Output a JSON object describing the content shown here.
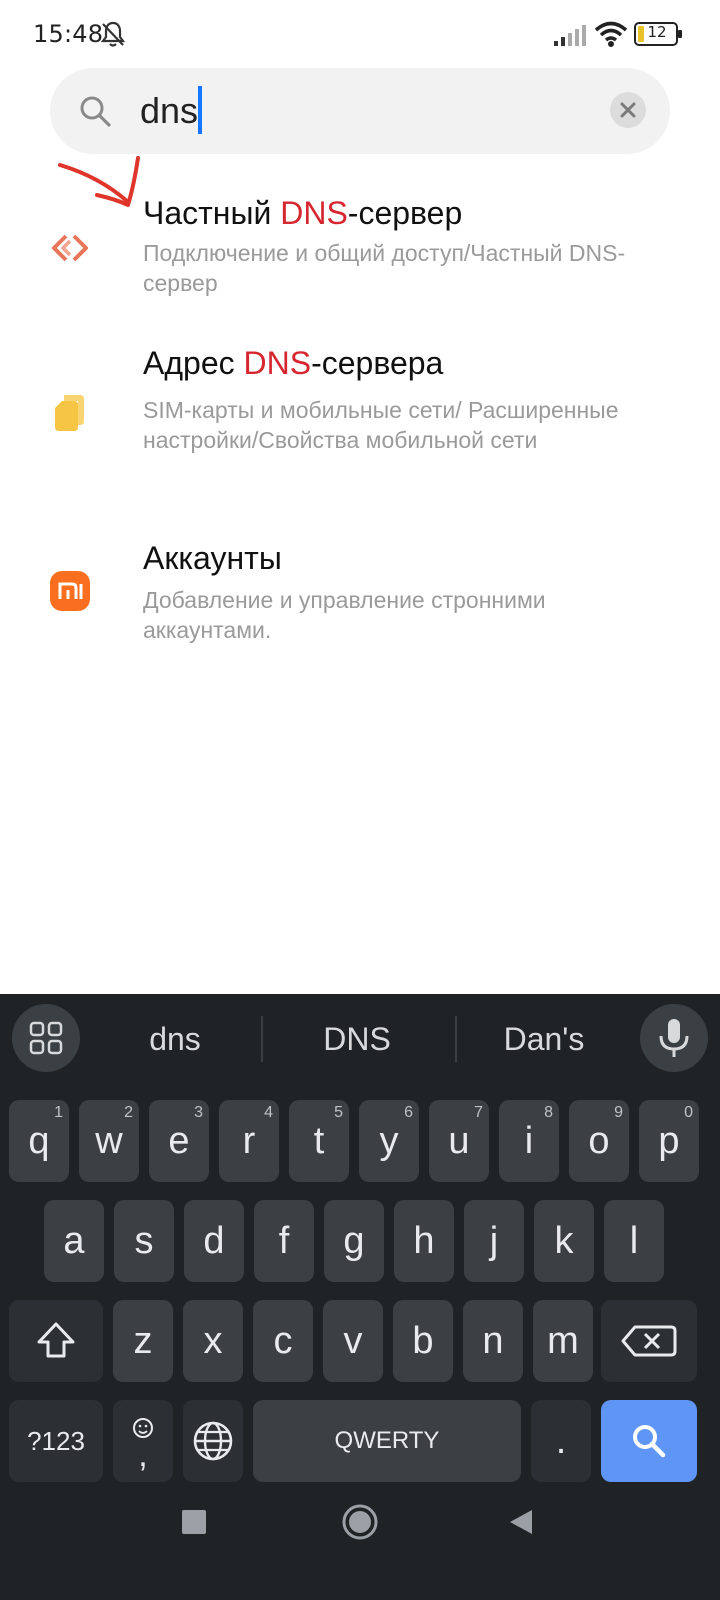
{
  "status_bar": {
    "time": "15:48",
    "battery": "12",
    "icons": [
      "bell-off-icon",
      "signal-icon",
      "wifi-icon",
      "battery-icon"
    ]
  },
  "search": {
    "query": "dns",
    "icon": "search-icon",
    "clear_icon": "close-icon"
  },
  "results": [
    {
      "title_before": "Частный ",
      "title_highlight": "DNS",
      "title_after": "-сервер",
      "subtitle": "Подключение и общий доступ/Частный DNS-сервер",
      "icon": "connection-share-icon",
      "icon_color": "#e8765a"
    },
    {
      "title_before": "Адрес ",
      "title_highlight": "DNS",
      "title_after": "-сервера",
      "subtitle": "SIM-карты и мобильные сети/ Расширенные настройки/Свойства мобильной сети",
      "icon": "sim-card-icon",
      "icon_color": "#f7c544"
    },
    {
      "title_before": "Аккаунты",
      "title_highlight": "",
      "title_after": "",
      "subtitle": "Добавление и управление стронними аккаунтами.",
      "icon": "mi-logo-icon",
      "icon_color": "#f96f1f"
    }
  ],
  "colors": {
    "highlight": "#d6262f",
    "keyboard_bg": "#1f2326",
    "key_bg": "#3c4043",
    "search_key": "#5f96f5",
    "annotation_arrow": "#e0352b"
  },
  "keyboard": {
    "suggestions": [
      "dns",
      "DNS",
      "Dan's"
    ],
    "row1": [
      {
        "k": "q",
        "h": "1"
      },
      {
        "k": "w",
        "h": "2"
      },
      {
        "k": "e",
        "h": "3"
      },
      {
        "k": "r",
        "h": "4"
      },
      {
        "k": "t",
        "h": "5"
      },
      {
        "k": "y",
        "h": "6"
      },
      {
        "k": "u",
        "h": "7"
      },
      {
        "k": "i",
        "h": "8"
      },
      {
        "k": "o",
        "h": "9"
      },
      {
        "k": "p",
        "h": "0"
      }
    ],
    "row2": [
      "a",
      "s",
      "d",
      "f",
      "g",
      "h",
      "j",
      "k",
      "l"
    ],
    "row3": [
      "z",
      "x",
      "c",
      "v",
      "b",
      "n",
      "m"
    ],
    "symbols_label": "?123",
    "comma_label": ",",
    "space_label": "QWERTY",
    "period_label": "."
  }
}
